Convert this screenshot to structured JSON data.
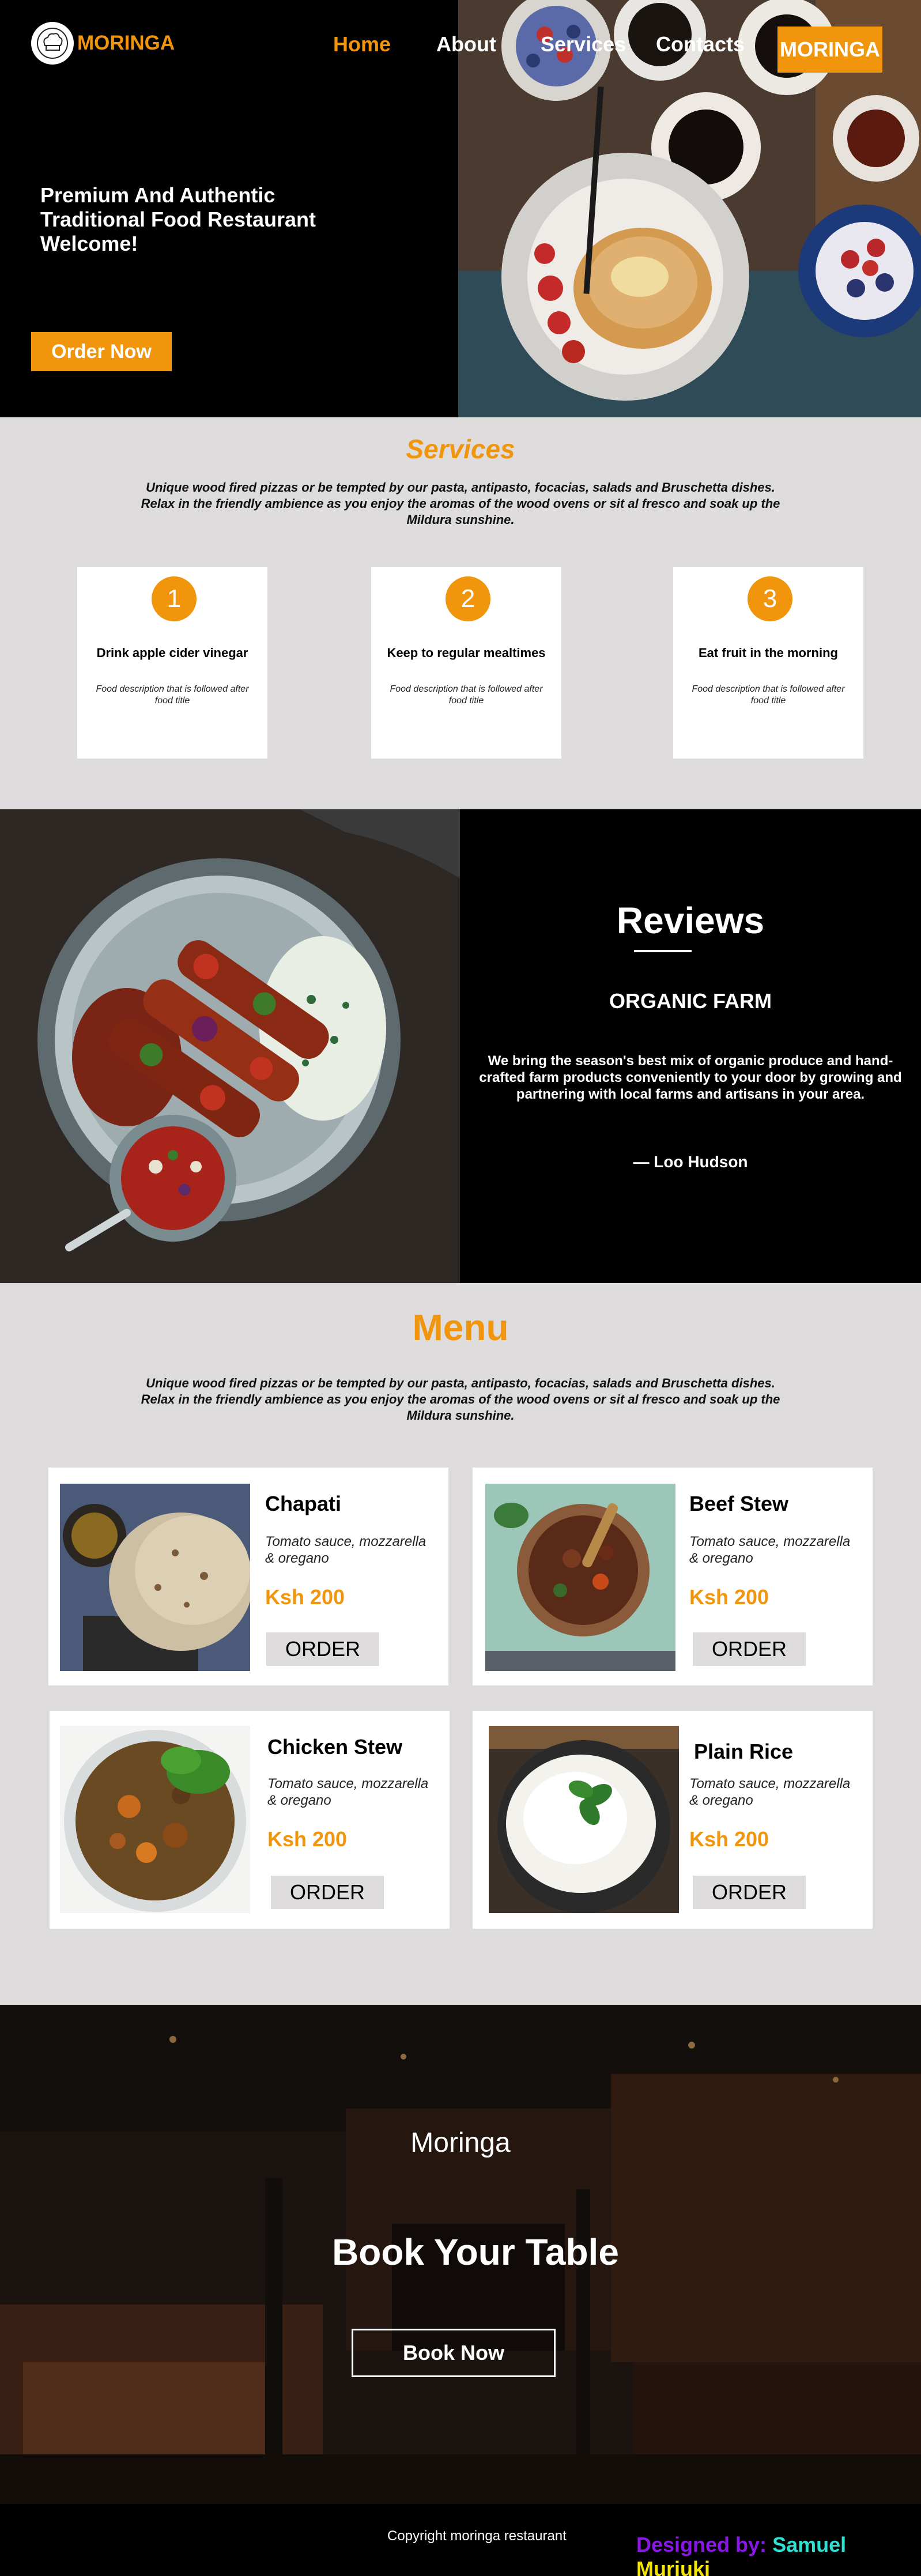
{
  "header": {
    "logo_text": "MORINGA",
    "nav": {
      "home": "Home",
      "about": "About",
      "services": "Services",
      "contacts": "Contacts",
      "brand_button": "MORINGA"
    },
    "hero_title": "Premium And Authentic Traditional Food Restaurant Welcome!",
    "order_button": "Order Now"
  },
  "services": {
    "heading": "Services",
    "description": "Unique wood fired pizzas or be tempted by our pasta, antipasto, focacias, salads and Bruschetta dishes. Relax in the friendly ambience as you enjoy the aromas of the wood ovens or sit al fresco and soak up the Mildura sunshine.",
    "cards": [
      {
        "number": "1",
        "title": "Drink apple cider vinegar",
        "description": "Food description that is followed after food title"
      },
      {
        "number": "2",
        "title": "Keep to regular mealtimes",
        "description": "Food description that is followed after food title"
      },
      {
        "number": "3",
        "title": "Eat fruit in the morning",
        "description": "Food description that is followed after food title"
      }
    ]
  },
  "reviews": {
    "heading": "Reviews",
    "subheading": "ORGANIC FARM",
    "text": "We bring the season's best mix of organic produce and hand-crafted farm products conveniently to your door by growing and partnering with local farms and artisans in your area.",
    "author": "— Loo Hudson"
  },
  "menu": {
    "heading": "Menu",
    "description": "Unique wood fired pizzas or be tempted by our pasta, antipasto, focacias, salads and Bruschetta dishes. Relax in the friendly ambience as you enjoy the aromas of the wood ovens or sit al fresco and soak up the Mildura sunshine.",
    "items": [
      {
        "name": "Chapati",
        "description": "Tomato sauce, mozzarella & oregano",
        "price": "Ksh 200",
        "button": "ORDER"
      },
      {
        "name": "Beef Stew",
        "description": "Tomato sauce, mozzarella & oregano",
        "price": "Ksh 200",
        "button": "ORDER"
      },
      {
        "name": "Chicken Stew",
        "description": "Tomato sauce, mozzarella & oregano",
        "price": "Ksh 200",
        "button": "ORDER"
      },
      {
        "name": "Plain Rice",
        "description": "Tomato sauce, mozzarella & oregano",
        "price": "Ksh 200",
        "button": "ORDER"
      }
    ]
  },
  "booking": {
    "subtitle": "Moringa",
    "title": "Book Your Table",
    "button": "Book Now"
  },
  "footer": {
    "copyright": "Copyright moringa restaurant",
    "designed_by_label": "Designed by:",
    "designer_first": "Samuel",
    "designer_last": "Muriuki"
  },
  "colors": {
    "accent": "#f0950c",
    "background": "#dedcdc",
    "dark": "#000000",
    "credit_label": "#8a17e6",
    "credit_first": "#2ee0d2",
    "credit_last": "#f5e600"
  }
}
